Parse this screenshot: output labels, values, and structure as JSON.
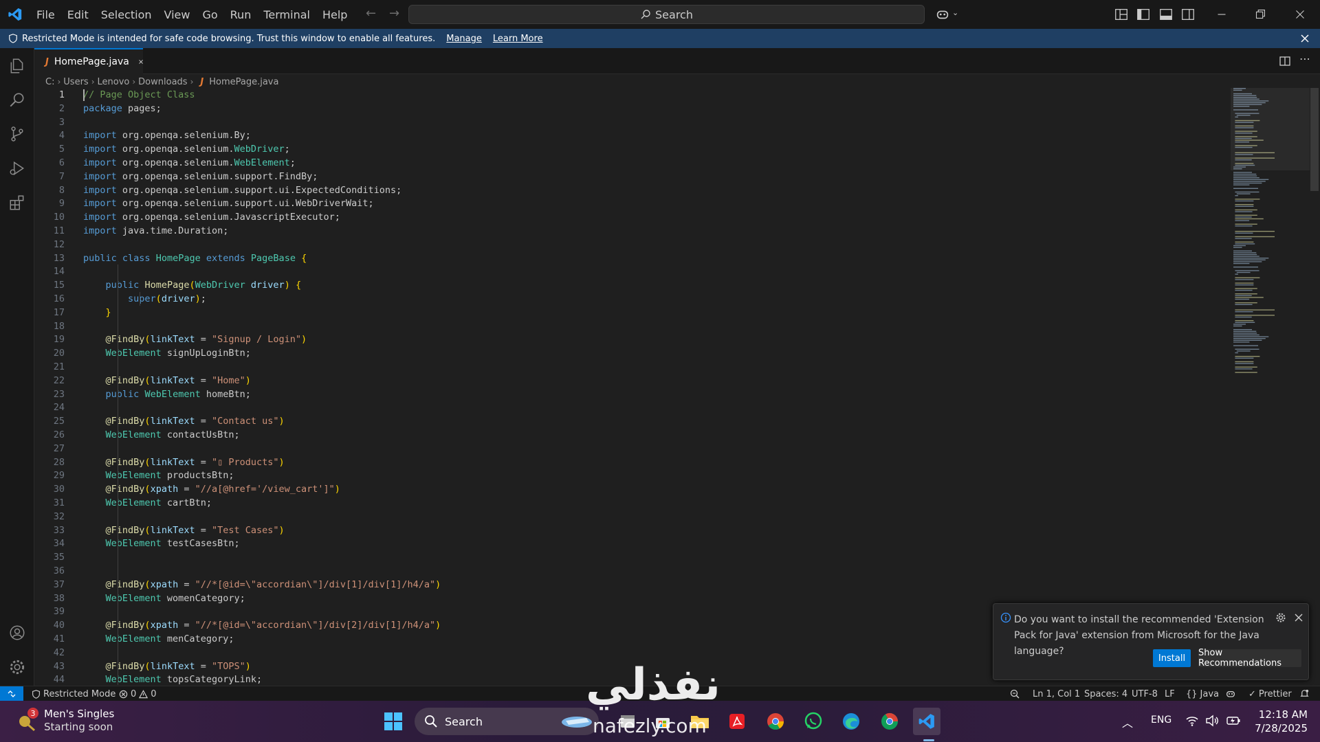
{
  "menu": [
    "File",
    "Edit",
    "Selection",
    "View",
    "Go",
    "Run",
    "Terminal",
    "Help"
  ],
  "command_center": {
    "label": "Search"
  },
  "banner": {
    "text": "Restricted Mode is intended for safe code browsing. Trust this window to enable all features.",
    "manage": "Manage",
    "learn_more": "Learn More"
  },
  "tab": {
    "filename": "HomePage.java",
    "icon_letter": "J"
  },
  "breadcrumb": [
    "C:",
    "Users",
    "Lenovo",
    "Downloads",
    "HomePage.java"
  ],
  "code_lines": [
    "// Page Object Class",
    "package pages;",
    "",
    "import org.openqa.selenium.By;",
    "import org.openqa.selenium.WebDriver;",
    "import org.openqa.selenium.WebElement;",
    "import org.openqa.selenium.support.FindBy;",
    "import org.openqa.selenium.support.ui.ExpectedConditions;",
    "import org.openqa.selenium.support.ui.WebDriverWait;",
    "import org.openqa.selenium.JavascriptExecutor;",
    "import java.time.Duration;",
    "",
    "public class HomePage extends PageBase {",
    "",
    "    public HomePage(WebDriver driver) {",
    "        super(driver);",
    "    }",
    "",
    "    @FindBy(linkText = \"Signup / Login\")",
    "    WebElement signUpLoginBtn;",
    "",
    "    @FindBy(linkText = \"Home\")",
    "    public WebElement homeBtn;",
    "",
    "    @FindBy(linkText = \"Contact us\")",
    "    WebElement contactUsBtn;",
    "",
    "    @FindBy(linkText = \"▯ Products\")",
    "    WebElement productsBtn;",
    "    @FindBy(xpath = \"//a[@href='/view_cart']\")",
    "    WebElement cartBtn;",
    "",
    "    @FindBy(linkText = \"Test Cases\")",
    "    WebElement testCasesBtn;",
    "",
    "",
    "    @FindBy(xpath = \"//*[@id=\\\"accordian\\\"]/div[1]/div[1]/h4/a\")",
    "    WebElement womenCategory;",
    "",
    "    @FindBy(xpath = \"//*[@id=\\\"accordian\\\"]/div[2]/div[1]/h4/a\")",
    "    WebElement menCategory;",
    "",
    "    @FindBy(linkText = \"TOPS\")",
    "    WebElement topsCategoryLink;"
  ],
  "notification": {
    "message": "Do you want to install the recommended 'Extension Pack for Java' extension from Microsoft for the Java language?",
    "install": "Install",
    "show_recommendations": "Show Recommendations"
  },
  "statusbar": {
    "restricted": "Restricted Mode",
    "errors": "0",
    "warnings": "0",
    "position": "Ln 1, Col 1",
    "spaces": "Spaces: 4",
    "encoding": "UTF-8",
    "eol": "LF",
    "language": "Java",
    "prettier": "Prettier"
  },
  "taskbar": {
    "widget_badge": "3",
    "widget_title": "Men's Singles",
    "widget_subtitle": "Starting soon",
    "search": "Search",
    "lang": "ENG",
    "time": "12:18 AM",
    "date": "7/28/2025"
  },
  "watermark": {
    "arabic": "نفذلي",
    "site": "nafezly.com"
  },
  "colors": {
    "accent": "#0078d4",
    "banner": "#1f3f63",
    "editor_bg": "#1f1f1f"
  }
}
